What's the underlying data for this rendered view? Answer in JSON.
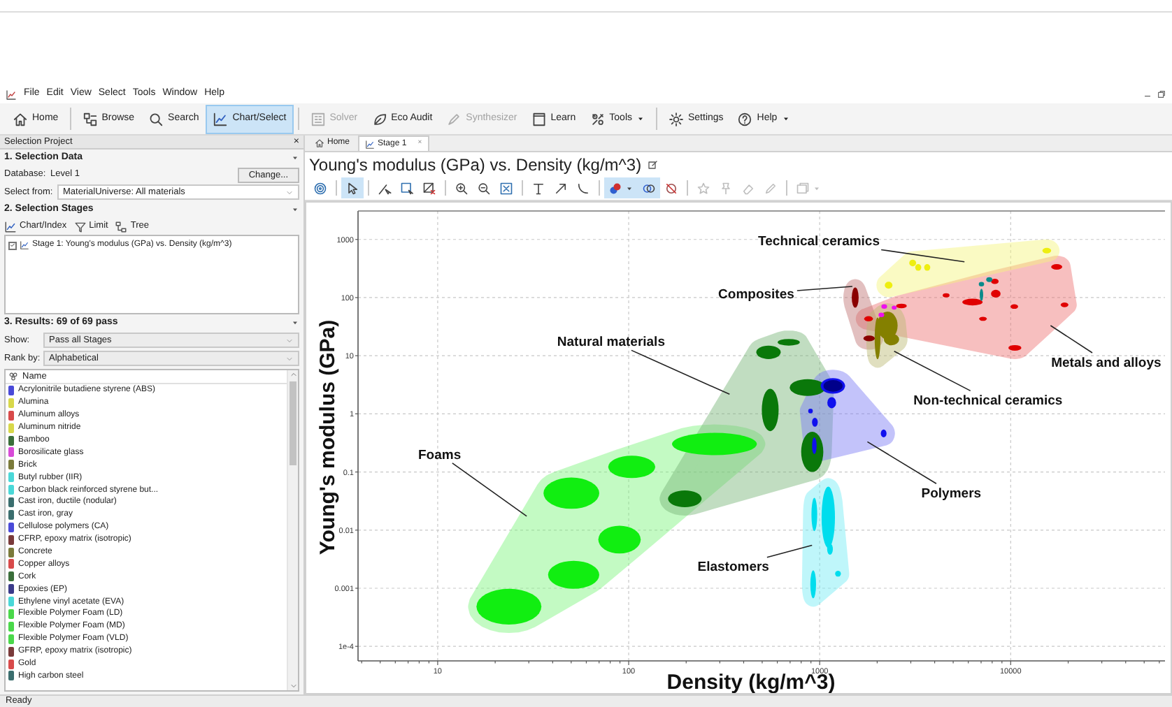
{
  "menu": [
    "File",
    "Edit",
    "View",
    "Select",
    "Tools",
    "Window",
    "Help"
  ],
  "ribbon": [
    {
      "kind": "home",
      "label": "Home",
      "selected": false,
      "disabled": false,
      "dropdown": false
    },
    {
      "kind": "separator"
    },
    {
      "kind": "browse",
      "label": "Browse",
      "selected": false,
      "disabled": false,
      "dropdown": false
    },
    {
      "kind": "search",
      "label": "Search",
      "selected": false,
      "disabled": false,
      "dropdown": false
    },
    {
      "kind": "chart",
      "label": "Chart/Select",
      "selected": true,
      "disabled": false,
      "dropdown": false
    },
    {
      "kind": "separator"
    },
    {
      "kind": "solver",
      "label": "Solver",
      "selected": false,
      "disabled": true,
      "dropdown": false
    },
    {
      "kind": "eco",
      "label": "Eco Audit",
      "selected": false,
      "disabled": false,
      "dropdown": false
    },
    {
      "kind": "synth",
      "label": "Synthesizer",
      "selected": false,
      "disabled": true,
      "dropdown": false
    },
    {
      "kind": "learn",
      "label": "Learn",
      "selected": false,
      "disabled": false,
      "dropdown": false
    },
    {
      "kind": "tools",
      "label": "Tools",
      "selected": false,
      "disabled": false,
      "dropdown": true
    },
    {
      "kind": "separator"
    },
    {
      "kind": "settings",
      "label": "Settings",
      "selected": false,
      "disabled": false,
      "dropdown": false
    },
    {
      "kind": "help",
      "label": "Help",
      "selected": false,
      "disabled": false,
      "dropdown": true
    }
  ],
  "left_panel": {
    "title": "Selection Project",
    "close": "×",
    "selection_data": {
      "heading": "1. Selection Data",
      "database_label": "Database:",
      "database": "Level 1",
      "change_button": "Change...",
      "select_from": {
        "label": "Select from:",
        "value": "MaterialUniverse: All materials",
        "disabled": false
      }
    },
    "selection_stages": {
      "heading": "2. Selection Stages",
      "tools": [
        {
          "kind": "chart",
          "label": "Chart/Index"
        },
        {
          "kind": "limit",
          "label": "Limit"
        },
        {
          "kind": "tree",
          "label": "Tree"
        }
      ],
      "stages": [
        {
          "label": "Stage 1: Young's modulus (GPa) vs. Density (kg/m^3)",
          "checked": true
        }
      ]
    },
    "results": {
      "heading": "3. Results: 69 of 69 pass",
      "show": {
        "label": "Show:",
        "value": "Pass all Stages",
        "disabled": true
      },
      "rank_by": {
        "label": "Rank by:",
        "value": "Alphabetical",
        "disabled": true
      },
      "column": "Name",
      "rows": [
        {
          "name": "Acrylonitrile butadiene styrene (ABS)",
          "color": "#4a4ad8"
        },
        {
          "name": "Alumina",
          "color": "#d8d84a"
        },
        {
          "name": "Aluminum alloys",
          "color": "#d84a4a"
        },
        {
          "name": "Aluminum nitride",
          "color": "#d8d84a"
        },
        {
          "name": "Bamboo",
          "color": "#3a6e3a"
        },
        {
          "name": "Borosilicate glass",
          "color": "#d84ad8"
        },
        {
          "name": "Brick",
          "color": "#7a7a3a"
        },
        {
          "name": "Butyl rubber (IIR)",
          "color": "#4ad8d8"
        },
        {
          "name": "Carbon black reinforced styrene but...",
          "color": "#4ad8d8"
        },
        {
          "name": "Cast iron, ductile (nodular)",
          "color": "#3a6e6e"
        },
        {
          "name": "Cast iron, gray",
          "color": "#3a6e6e"
        },
        {
          "name": "Cellulose polymers (CA)",
          "color": "#4a4ad8"
        },
        {
          "name": "CFRP, epoxy matrix (isotropic)",
          "color": "#7a3a3a"
        },
        {
          "name": "Concrete",
          "color": "#7a7a3a"
        },
        {
          "name": "Copper alloys",
          "color": "#d84a4a"
        },
        {
          "name": "Cork",
          "color": "#3a6e3a"
        },
        {
          "name": "Epoxies (EP)",
          "color": "#3a3a8a"
        },
        {
          "name": "Ethylene vinyl acetate (EVA)",
          "color": "#4ad8d8"
        },
        {
          "name": "Flexible Polymer Foam (LD)",
          "color": "#4ad84a"
        },
        {
          "name": "Flexible Polymer Foam (MD)",
          "color": "#4ad84a"
        },
        {
          "name": "Flexible Polymer Foam (VLD)",
          "color": "#4ad84a"
        },
        {
          "name": "GFRP, epoxy matrix (isotropic)",
          "color": "#7a3a3a"
        },
        {
          "name": "Gold",
          "color": "#d84a4a"
        },
        {
          "name": "High carbon steel",
          "color": "#3a6e6e"
        }
      ]
    }
  },
  "tabs": [
    {
      "kind": "home",
      "label": "Home",
      "selected": false
    },
    {
      "kind": "chart",
      "label": "Stage 1",
      "selected": true,
      "close": "×"
    }
  ],
  "chart_title": "Young's modulus (GPa) vs. Density (kg/m^3)",
  "chart_toolbar": [
    {
      "kind": "layers",
      "selected": false,
      "disabled": false,
      "dropdown": false
    },
    {
      "kind": "separator"
    },
    {
      "kind": "pointer",
      "selected": true,
      "disabled": false,
      "dropdown": false
    },
    {
      "kind": "separator"
    },
    {
      "kind": "line_select",
      "selected": false,
      "disabled": false,
      "dropdown": false
    },
    {
      "kind": "box_select",
      "selected": false,
      "disabled": false,
      "dropdown": false
    },
    {
      "kind": "delete_select",
      "selected": false,
      "disabled": false,
      "dropdown": false
    },
    {
      "kind": "separator"
    },
    {
      "kind": "zoom_in",
      "selected": false,
      "disabled": false,
      "dropdown": false
    },
    {
      "kind": "zoom_out",
      "selected": false,
      "disabled": false,
      "dropdown": false
    },
    {
      "kind": "fit",
      "selected": false,
      "disabled": false,
      "dropdown": false
    },
    {
      "kind": "separator"
    },
    {
      "kind": "text",
      "selected": false,
      "disabled": false,
      "dropdown": false
    },
    {
      "kind": "arrow",
      "selected": false,
      "disabled": false,
      "dropdown": false
    },
    {
      "kind": "curve",
      "selected": false,
      "disabled": false,
      "dropdown": false
    },
    {
      "kind": "separator"
    },
    {
      "kind": "color",
      "selected": true,
      "disabled": false,
      "dropdown": true
    },
    {
      "kind": "overlap",
      "selected": true,
      "disabled": false,
      "dropdown": false
    },
    {
      "kind": "hide",
      "selected": false,
      "disabled": false,
      "dropdown": false
    },
    {
      "kind": "separator"
    },
    {
      "kind": "star",
      "selected": false,
      "disabled": true,
      "dropdown": false
    },
    {
      "kind": "pin",
      "selected": false,
      "disabled": true,
      "dropdown": false
    },
    {
      "kind": "eraser",
      "selected": false,
      "disabled": true,
      "dropdown": false
    },
    {
      "kind": "pencil",
      "selected": false,
      "disabled": true,
      "dropdown": false
    },
    {
      "kind": "separator"
    },
    {
      "kind": "export",
      "selected": false,
      "disabled": true,
      "dropdown": true
    }
  ],
  "property_chart": {
    "x_title": "Density (kg/m^3)",
    "y_title": "Young's modulus (GPa)",
    "x_tick_labels": [
      "10",
      "100",
      "1000",
      "10000"
    ],
    "y_tick_labels": [
      "1000",
      "100",
      "10",
      "1",
      "0.1",
      "0.01",
      "0.001",
      "1e-4"
    ],
    "regions": [
      {
        "label": "Foams",
        "color": "#11ee11"
      },
      {
        "label": "Natural materials",
        "color": "#0a780a"
      },
      {
        "label": "Polymers",
        "color": "#1010ee"
      },
      {
        "label": "Elastomers",
        "color": "#00dded"
      },
      {
        "label": "Metals and alloys",
        "color": "#e00000"
      },
      {
        "label": "Composites",
        "color": "#8a0000"
      },
      {
        "label": "Technical ceramics",
        "color": "#eeee10"
      },
      {
        "label": "Non-technical ceramics",
        "color": "#848000"
      },
      {
        "color": "#0a8a8a"
      },
      {
        "color": "#ee10ee"
      },
      {
        "color": "#00008a"
      }
    ]
  },
  "status_bar": "Ready"
}
